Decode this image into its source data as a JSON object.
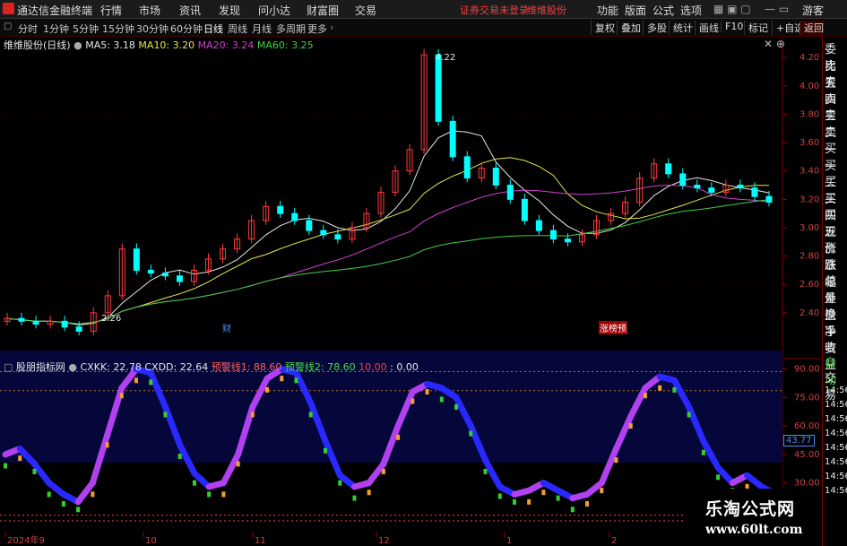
{
  "app": {
    "title": "通达信金融终端",
    "menu": [
      "行情",
      "市场",
      "资讯",
      "发现",
      "问小达",
      "财富圈",
      "交易"
    ],
    "status_login": "证券交易未登录",
    "status_stock": "维维股份",
    "right_menu": [
      "功能",
      "版面",
      "公式",
      "选项"
    ],
    "guest": "游客"
  },
  "periods": {
    "items": [
      "分时",
      "1分钟",
      "5分钟",
      "15分钟",
      "30分钟",
      "60分钟",
      "日线",
      "周线",
      "月线",
      "多周期",
      "更多"
    ],
    "active": "日线",
    "tools": [
      "复权",
      "叠加",
      "多股",
      "统计",
      "画线",
      "F10",
      "标记",
      "+自选"
    ],
    "back": "返回"
  },
  "main_chart": {
    "stock_label": "维维股份(日线)",
    "ma": [
      {
        "label": "MA5: 3.18",
        "color": "#e8e8e8"
      },
      {
        "label": "MA10: 3.20",
        "color": "#e6e64a"
      },
      {
        "label": "MA20: 3.24",
        "color": "#d040d0"
      },
      {
        "label": "MA60: 3.25",
        "color": "#40d040"
      }
    ],
    "high_marker": "4.22",
    "low_marker": "2.26",
    "badge_cai": "财",
    "badge_zt": "涨榜",
    "badge_jian": "预",
    "y_ticks": [
      "4.20",
      "4.00",
      "3.80",
      "3.60",
      "3.40",
      "3.20",
      "3.00",
      "2.80",
      "2.60",
      "2.40"
    ],
    "colors": {
      "up": "#ff3c3c",
      "down": "#00ffff",
      "grid": "#500000"
    }
  },
  "indicator": {
    "title": "股朋指标网",
    "items": [
      {
        "label": "CXKK: 22.78",
        "color": "#e8e8e8"
      },
      {
        "label": "CXDD: 22.64",
        "color": "#e8e8e8"
      },
      {
        "label": "预警线1: 88.60",
        "color": "#ff6060"
      },
      {
        "label": "预警线2: 78.60",
        "color": "#40e040"
      },
      {
        "label": "10.00",
        "color": "#ff4040"
      },
      {
        "label": ": 0.00",
        "color": "#e8e8e8"
      }
    ],
    "y_ticks": [
      "90.00",
      "75.00",
      "60.00",
      "45.00",
      "30.00"
    ],
    "current": "43.77"
  },
  "x_axis": [
    "2024年9",
    "10",
    "11",
    "12",
    "1",
    "2"
  ],
  "side": {
    "labels": [
      "委比",
      "卖五",
      "卖四",
      "卖三",
      "卖二",
      "卖一",
      "买一",
      "买二",
      "买三",
      "买四",
      "买五",
      "现价",
      "涨跌",
      "涨幅",
      "总量",
      "外盘",
      "换手",
      "净资",
      "收益"
    ],
    "auto": "自动",
    "trade": "交易",
    "times": [
      "14:56",
      "14:56",
      "14:56",
      "14:56",
      "14:56",
      "14:56",
      "14:56",
      "14:56"
    ]
  },
  "watermark": {
    "line1": "乐淘公式网",
    "line2": "www.60lt.com"
  },
  "chart_data": {
    "type": "line",
    "x": [
      "2024年9",
      "10",
      "11",
      "12",
      "1",
      "2"
    ],
    "candle_close": [
      2.36,
      2.34,
      2.32,
      2.34,
      2.3,
      2.27,
      2.4,
      2.52,
      2.85,
      2.7,
      2.68,
      2.66,
      2.62,
      2.7,
      2.78,
      2.85,
      2.92,
      3.05,
      3.15,
      3.1,
      3.05,
      2.98,
      2.95,
      2.92,
      3.0,
      3.1,
      3.25,
      3.4,
      3.55,
      4.22,
      3.75,
      3.5,
      3.35,
      3.42,
      3.3,
      3.2,
      3.05,
      2.98,
      2.92,
      2.9,
      2.95,
      3.05,
      3.1,
      3.18,
      3.35,
      3.45,
      3.38,
      3.3,
      3.28,
      3.25,
      3.3,
      3.28,
      3.22,
      3.18
    ],
    "ma": {
      "MA5": 3.18,
      "MA10": 3.2,
      "MA20": 3.24,
      "MA60": 3.25
    },
    "price_range": [
      2.26,
      4.22
    ],
    "ylim_price": [
      2.26,
      4.22
    ],
    "indicator_range": [
      10,
      95
    ],
    "warning_lines": {
      "预警线1": 88.6,
      "预警线2": 78.6
    },
    "cxkk": 22.78,
    "cxdd": 22.64,
    "current_marker": 43.77
  }
}
